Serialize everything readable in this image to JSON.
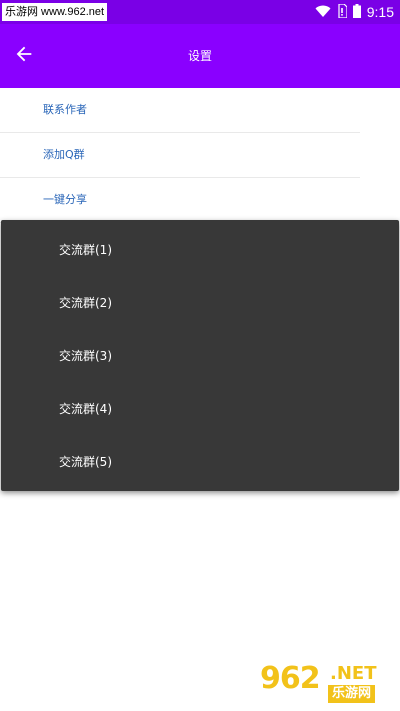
{
  "status_bar": {
    "watermark_text": "乐游网 www.962.net",
    "time": "9:15",
    "icons": [
      "wifi-icon",
      "sim-icon",
      "battery-icon"
    ]
  },
  "app_bar": {
    "title": "设置",
    "back_icon": "arrow-left-icon",
    "color": "#8a00ff"
  },
  "settings": {
    "items": [
      {
        "label": "联系作者"
      },
      {
        "label": "添加Q群"
      },
      {
        "label": "一键分享"
      }
    ]
  },
  "popup_menu": {
    "items": [
      {
        "label": "交流群(1)"
      },
      {
        "label": "交流群(2)"
      },
      {
        "label": "交流群(3)"
      },
      {
        "label": "交流群(4)"
      },
      {
        "label": "交流群(5)"
      }
    ]
  },
  "watermark": {
    "num": "962",
    "domain": ".NET",
    "cn": "乐游网"
  }
}
